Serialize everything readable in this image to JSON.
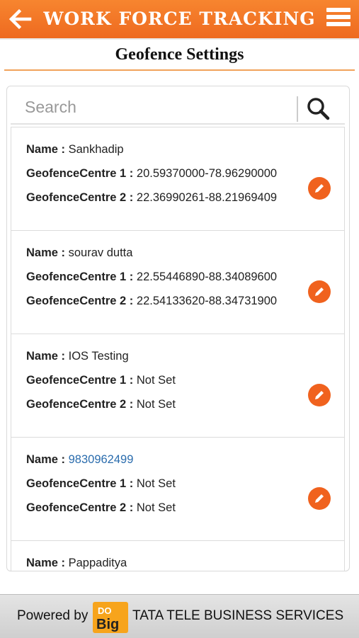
{
  "header": {
    "title": "WORK FORCE TRACKING",
    "back_icon": "arrow-left-icon",
    "menu_icon": "hamburger-menu-icon"
  },
  "page": {
    "title": "Geofence Settings"
  },
  "search": {
    "placeholder": "Search",
    "value": "",
    "icon": "search-icon"
  },
  "labels": {
    "name": "Name :",
    "centre1": "GeofenceCentre 1 :",
    "centre2": "GeofenceCentre 2 :"
  },
  "records": [
    {
      "name": "Sankhadip",
      "centre1": "20.59370000-78.96290000",
      "centre2": "22.36990261-88.21969409"
    },
    {
      "name": "sourav dutta",
      "centre1": "22.55446890-88.34089600",
      "centre2": "22.54133620-88.34731900"
    },
    {
      "name": "IOS Testing",
      "centre1": "Not Set",
      "centre2": "Not Set"
    },
    {
      "name": "9830962499",
      "centre1": "Not Set",
      "centre2": "Not Set"
    },
    {
      "name": "Pappaditya"
    }
  ],
  "footer": {
    "powered_by": "Powered by",
    "logo_top": "DO",
    "logo_bottom": "Big",
    "company": "TATA TELE BUSINESS SERVICES"
  },
  "colors": {
    "accent": "#ee6a20",
    "edit_button": "#f0621e",
    "link": "#2a6cad"
  }
}
